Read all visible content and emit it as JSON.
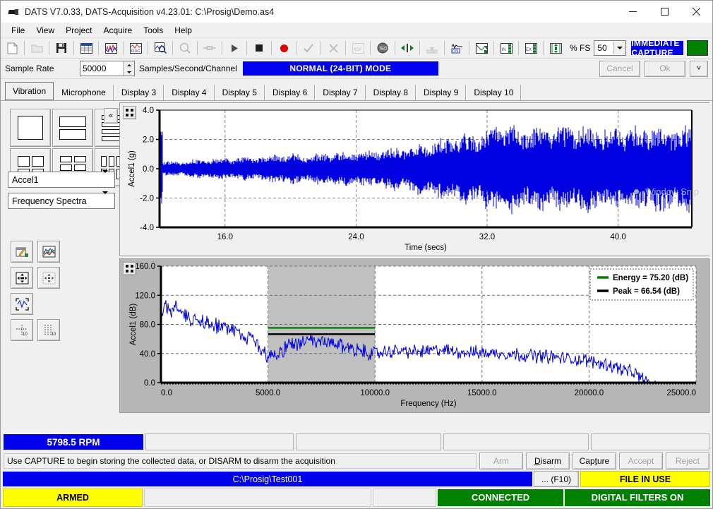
{
  "window": {
    "title": "DATS V7.0.33, DATS-Acquisition v4.23.01: C:\\Prosig\\Demo.as4",
    "minimize": "minimize-icon",
    "maximize": "maximize-icon",
    "close": "close-icon"
  },
  "menu": {
    "items": [
      "File",
      "View",
      "Project",
      "Acquire",
      "Tools",
      "Help"
    ]
  },
  "toolbar": {
    "icons": [
      "new-document-icon",
      "open-folder-icon",
      "save-disk-icon",
      "spreadsheet-icon",
      "plot-signal-icon",
      "plot-dac-icon",
      "zoom-plot-icon",
      "magnifier-icon",
      "connector-icon",
      "play-icon",
      "stop-icon",
      "record-icon",
      "check-icon",
      "cross-icon",
      "rdf-icon",
      "ted-icon",
      "align-center-icon",
      "low-limit-icon",
      "on-signal-icon",
      "export-plot-icon",
      "input-channels-icon",
      "export-channels-icon",
      "move-channels-icon"
    ],
    "pct_fs_label": "% FS",
    "pct_fs_value": "50",
    "capture_banner": "IMMEDIATE CAPTURE",
    "status_lamp_color": "#008000"
  },
  "sample_rate": {
    "label": "Sample Rate",
    "value": "50000",
    "units": "Samples/Second/Channel",
    "mode_banner": "NORMAL (24-BIT) MODE",
    "cancel": "Cancel",
    "ok": "Ok",
    "expand": "chevron-double-down-icon"
  },
  "tabs": {
    "items": [
      {
        "label": "Vibration",
        "active": true
      },
      {
        "label": "Microphone",
        "active": false
      },
      {
        "label": "Display 3",
        "active": false
      },
      {
        "label": "Display 4",
        "active": false
      },
      {
        "label": "Display 5",
        "active": false
      },
      {
        "label": "Display 6",
        "active": false
      },
      {
        "label": "Display 7",
        "active": false
      },
      {
        "label": "Display 8",
        "active": false
      },
      {
        "label": "Display 9",
        "active": false
      },
      {
        "label": "Display 10",
        "active": false
      }
    ]
  },
  "left_panel": {
    "layout_buttons": [
      "layout-1x1-icon",
      "layout-1x2-icon",
      "layout-1x4-icon",
      "layout-2x2-icon",
      "layout-2x3-icon",
      "layout-4x2-icon"
    ],
    "collapse_label": "«",
    "channel_select": "Accel1",
    "view_select": "Frequency Spectra",
    "tool_icons": [
      "plot-settings-icon",
      "plot-style-icon",
      "autoscale-both-icon",
      "autoscale-grid-icon",
      "expand-waveform-icon",
      "x-cursor-icon",
      "y-cursor-icon"
    ]
  },
  "charts": [
    {
      "name": "time-history-plot",
      "expand_icon": "expand-plot-icon"
    },
    {
      "name": "frequency-spectrum-plot",
      "expand_icon": "expand-plot-icon"
    }
  ],
  "chart_data": [
    {
      "type": "line",
      "name": "time-history",
      "title": "",
      "xlabel": "Time (secs)",
      "ylabel": "Accel1 (g)",
      "xlim": [
        12.0,
        44.5
      ],
      "ylim": [
        -4.0,
        4.0
      ],
      "xticks": [
        "16.0",
        "24.0",
        "32.0",
        "40.0"
      ],
      "xtick_values": [
        16.0,
        24.0,
        32.0,
        40.0
      ],
      "yticks": [
        "4.0",
        "2.0",
        "0.0",
        "-2.0",
        "-4.0"
      ],
      "ytick_values": [
        4.0,
        2.0,
        0.0,
        -2.0,
        -4.0
      ],
      "grid": true,
      "series_color": "#0000e0",
      "description": "Broadband vibration time history, amplitude envelope growing from about +/-0.5 g near 13 s to about +/-3.0 g beyond 33 s",
      "envelope": [
        {
          "t": 12.2,
          "amp": 0.45
        },
        {
          "t": 13.5,
          "amp": 0.55
        },
        {
          "t": 15.0,
          "amp": 0.7
        },
        {
          "t": 16.5,
          "amp": 0.75
        },
        {
          "t": 18.0,
          "amp": 0.8
        },
        {
          "t": 19.5,
          "amp": 1.05
        },
        {
          "t": 21.0,
          "amp": 0.95
        },
        {
          "t": 22.5,
          "amp": 1.1
        },
        {
          "t": 24.0,
          "amp": 1.15
        },
        {
          "t": 25.5,
          "amp": 1.3
        },
        {
          "t": 27.0,
          "amp": 1.55
        },
        {
          "t": 28.5,
          "amp": 1.9
        },
        {
          "t": 30.0,
          "amp": 2.25
        },
        {
          "t": 31.5,
          "amp": 2.55
        },
        {
          "t": 33.0,
          "amp": 3.05
        },
        {
          "t": 34.5,
          "amp": 2.8
        },
        {
          "t": 36.0,
          "amp": 2.85
        },
        {
          "t": 37.5,
          "amp": 2.95
        },
        {
          "t": 39.0,
          "amp": 2.8
        },
        {
          "t": 40.5,
          "amp": 2.9
        },
        {
          "t": 42.0,
          "amp": 2.95
        },
        {
          "t": 43.5,
          "amp": 2.9
        },
        {
          "t": 44.4,
          "amp": 2.95
        }
      ]
    },
    {
      "type": "line",
      "name": "frequency-spectrum",
      "title": "",
      "xlabel": "Frequency (Hz)",
      "ylabel": "Accel1 (dB)",
      "xlim": [
        0.0,
        25000.0
      ],
      "ylim": [
        0.0,
        160.0
      ],
      "xticks": [
        "0.0",
        "5000.0",
        "10000.0",
        "15000.0",
        "20000.0",
        "25000.0"
      ],
      "xtick_values": [
        0,
        5000,
        10000,
        15000,
        20000,
        25000
      ],
      "yticks": [
        "160.0",
        "120.0",
        "80.0",
        "40.0",
        "0.0"
      ],
      "ytick_values": [
        160.0,
        120.0,
        80.0,
        40.0,
        0.0
      ],
      "grid": true,
      "series_color": "#0000e0",
      "band_cursor": {
        "from": 5000.0,
        "to": 10000.0,
        "fill": "#c0c0c0"
      },
      "legend": [
        {
          "label": "Energy = 75.20 (dB)",
          "color": "#008000"
        },
        {
          "label": "Peak = 66.54 (dB)",
          "color": "#000000"
        }
      ],
      "markers": [
        {
          "name": "energy-line",
          "value": 75.2,
          "color": "#008000",
          "from": 5000.0,
          "to": 10000.0
        },
        {
          "name": "peak-line",
          "value": 66.54,
          "color": "#000000",
          "from": 5000.0,
          "to": 10000.0
        }
      ],
      "spectrum": [
        {
          "f": 0,
          "db": 92
        },
        {
          "f": 250,
          "db": 104
        },
        {
          "f": 500,
          "db": 99
        },
        {
          "f": 750,
          "db": 107
        },
        {
          "f": 1000,
          "db": 97
        },
        {
          "f": 1250,
          "db": 90
        },
        {
          "f": 1500,
          "db": 86
        },
        {
          "f": 1750,
          "db": 88
        },
        {
          "f": 2000,
          "db": 83
        },
        {
          "f": 2250,
          "db": 86
        },
        {
          "f": 2500,
          "db": 80
        },
        {
          "f": 2750,
          "db": 76
        },
        {
          "f": 3000,
          "db": 79
        },
        {
          "f": 3250,
          "db": 71
        },
        {
          "f": 3500,
          "db": 69
        },
        {
          "f": 3750,
          "db": 62
        },
        {
          "f": 4000,
          "db": 59
        },
        {
          "f": 4250,
          "db": 63
        },
        {
          "f": 4500,
          "db": 52
        },
        {
          "f": 4750,
          "db": 44
        },
        {
          "f": 5000,
          "db": 38
        },
        {
          "f": 5500,
          "db": 40
        },
        {
          "f": 6000,
          "db": 52
        },
        {
          "f": 6500,
          "db": 55
        },
        {
          "f": 7000,
          "db": 56
        },
        {
          "f": 7500,
          "db": 55
        },
        {
          "f": 8000,
          "db": 54
        },
        {
          "f": 8500,
          "db": 50
        },
        {
          "f": 9000,
          "db": 47
        },
        {
          "f": 9500,
          "db": 42
        },
        {
          "f": 10000,
          "db": 40
        },
        {
          "f": 11000,
          "db": 44
        },
        {
          "f": 12000,
          "db": 42
        },
        {
          "f": 13000,
          "db": 45
        },
        {
          "f": 14000,
          "db": 42
        },
        {
          "f": 15000,
          "db": 41
        },
        {
          "f": 16000,
          "db": 40
        },
        {
          "f": 17000,
          "db": 38
        },
        {
          "f": 18000,
          "db": 36
        },
        {
          "f": 19000,
          "db": 33
        },
        {
          "f": 20000,
          "db": 30
        },
        {
          "f": 21000,
          "db": 24
        },
        {
          "f": 22000,
          "db": 14
        },
        {
          "f": 22500,
          "db": 6
        },
        {
          "f": 23000,
          "db": 0
        }
      ]
    }
  ],
  "watermark": {
    "label": "Window Snip"
  },
  "rpm_row": {
    "value": "5798.5 RPM"
  },
  "hint_row": {
    "message": "Use CAPTURE to begin storing the collected data, or DISARM to disarm the acquisition",
    "buttons": [
      {
        "label": "Arm",
        "enabled": false
      },
      {
        "label": "Disarm",
        "enabled": true
      },
      {
        "label": "Capture",
        "enabled": true
      },
      {
        "label": "Accept",
        "enabled": false
      },
      {
        "label": "Reject",
        "enabled": false
      }
    ]
  },
  "file_row": {
    "path": "C:\\Prosig\\Test001",
    "browse": "... (F10)",
    "file_state": "FILE IN USE"
  },
  "status_row": {
    "armed": "ARMED",
    "connected": "CONNECTED",
    "filters": "DIGITAL FILTERS ON"
  },
  "colors": {
    "blue_banner": "#0000ee",
    "green_status": "#008000",
    "yellow_status": "#ffff00",
    "trace": "#0000e0"
  }
}
